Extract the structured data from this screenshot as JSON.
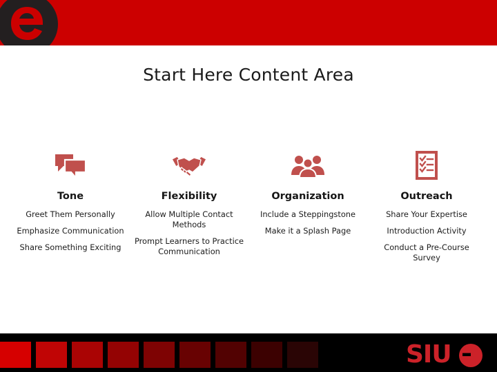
{
  "header": {
    "background_color": "#cc0000",
    "logo_icon": "e-logo-icon",
    "logo_letter": "e"
  },
  "slide": {
    "title": "Start Here Content Area"
  },
  "columns": [
    {
      "icon": "speech-bubbles-icon",
      "heading": "Tone",
      "items": [
        "Greet Them Personally",
        "Emphasize Communication",
        "Share Something Exciting"
      ]
    },
    {
      "icon": "handshake-icon",
      "heading": "Flexibility",
      "items": [
        "Allow Multiple Contact Methods",
        "Prompt Learners to Practice Communication"
      ]
    },
    {
      "icon": "people-group-icon",
      "heading": "Organization",
      "items": [
        "Include a Steppingstone",
        "Make it a Splash Page"
      ]
    },
    {
      "icon": "checklist-icon",
      "heading": "Outreach",
      "items": [
        "Share Your Expertise",
        "Introduction Activity",
        "Conduct a Pre-Course Survey"
      ]
    }
  ],
  "icon_color": "#c0504d",
  "footer": {
    "background_color": "#000000",
    "brand_text": "SIUE",
    "swatch_colors": [
      "#d60000",
      "#c00505",
      "#aa0404",
      "#940303",
      "#7e0303",
      "#680202",
      "#520202",
      "#3c0101",
      "#2a0505"
    ]
  }
}
